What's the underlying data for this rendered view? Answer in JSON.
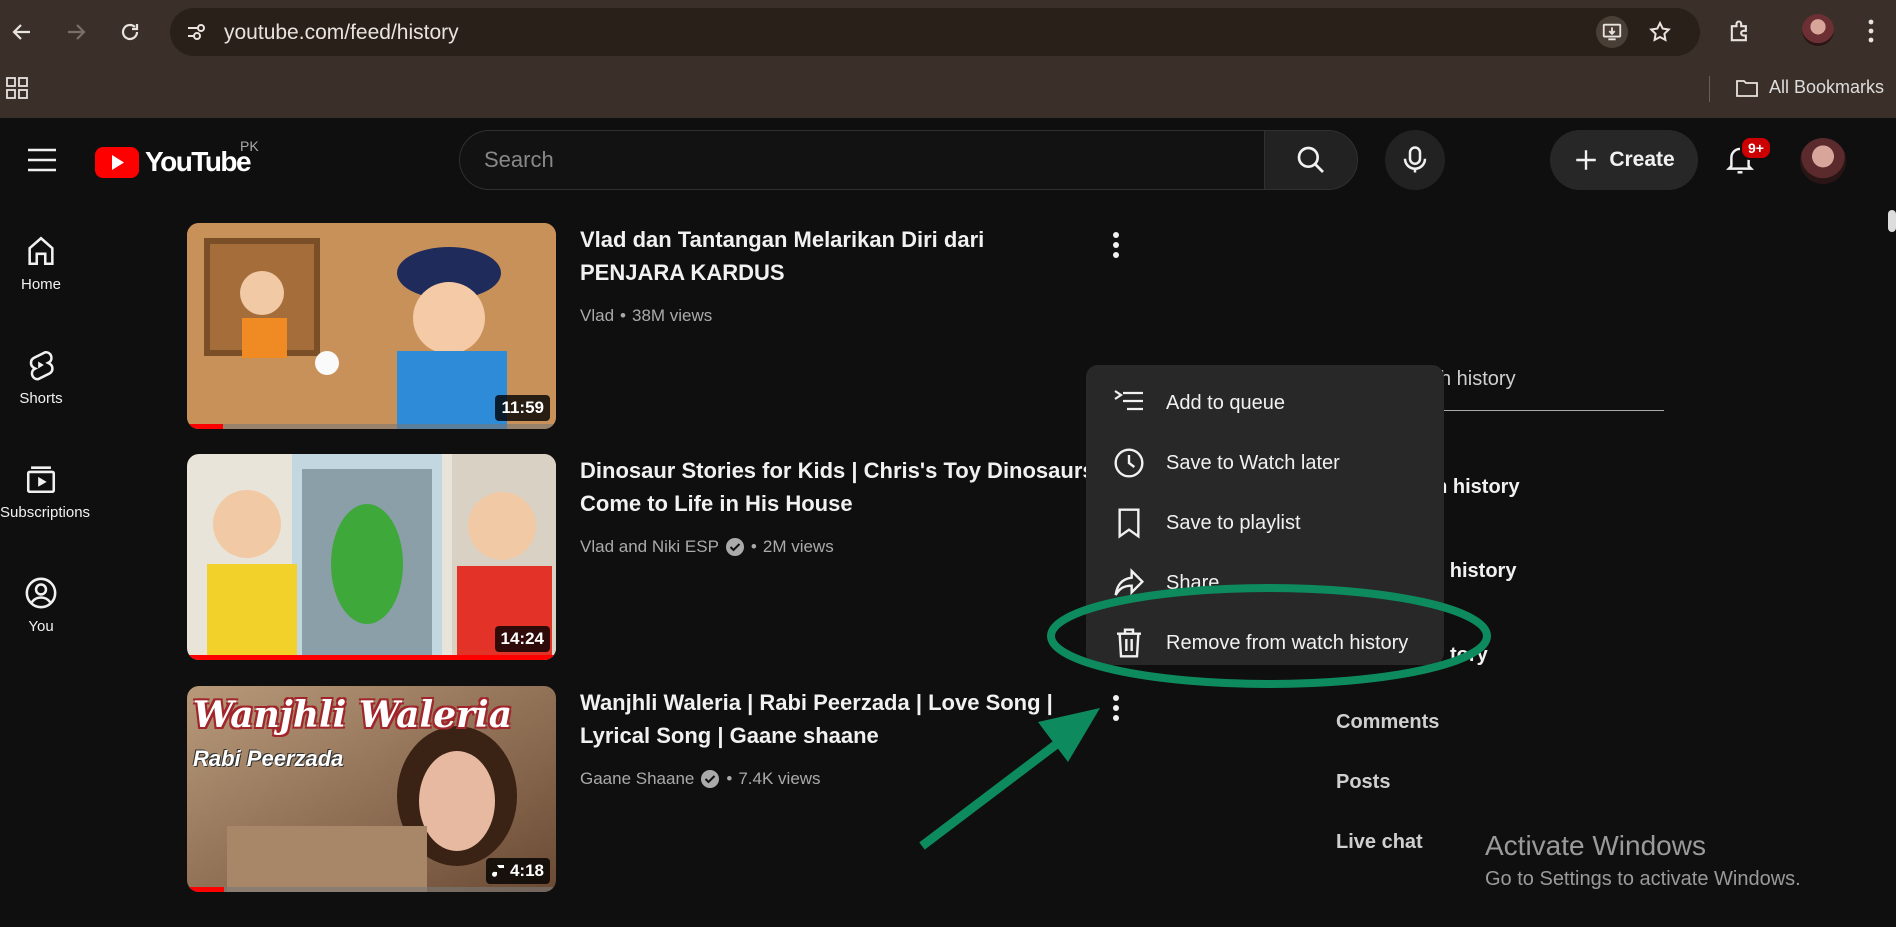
{
  "browser": {
    "url": "youtube.com/feed/history",
    "bookmarks_label": "All Bookmarks"
  },
  "masthead": {
    "logo_text": "YouTube",
    "region": "PK",
    "search_placeholder": "Search",
    "create_label": "Create",
    "notification_count": "9+"
  },
  "sidebar": {
    "items": [
      {
        "label": "Home",
        "icon": "home-icon"
      },
      {
        "label": "Shorts",
        "icon": "shorts-icon"
      },
      {
        "label": "Subscriptions",
        "icon": "subscriptions-icon"
      },
      {
        "label": "You",
        "icon": "you-icon"
      }
    ]
  },
  "videos": [
    {
      "title_line1": "Vlad dan Tantangan Melarikan Diri dari",
      "title_line2": "PENJARA KARDUS",
      "channel": "Vlad",
      "views": "38M views",
      "duration": "11:59",
      "verified": false,
      "watched": 0.08
    },
    {
      "title_line1": "Dinosaur Stories for Kids | Chris's Toy Dinosaurs",
      "title_line2": "Come to Life in His House",
      "channel": "Vlad and Niki ESP",
      "views": "2M views",
      "duration": "14:24",
      "verified": true,
      "watched": 1.0
    },
    {
      "title_line1": "Wanjhli Waleria | Rabi Peerzada | Love Song |",
      "title_line2": "Lyrical Song | Gaane shaane",
      "channel": "Gaane Shaane",
      "views": "7.4K views",
      "duration": "4:18",
      "verified": true,
      "watched": 0.1,
      "thumb_text_1": "Wanjhli Waleria",
      "thumb_text_2": "Rabi Peerzada"
    }
  ],
  "right_panel": {
    "search_partial": "ch history",
    "item1_partial": "ch history",
    "item2_partial": "h history",
    "item3_partial": "tory",
    "comments": "Comments",
    "posts": "Posts",
    "live_chat": "Live chat"
  },
  "context_menu": {
    "items": [
      {
        "label": "Add to queue",
        "icon": "queue-icon"
      },
      {
        "label": "Save to Watch later",
        "icon": "clock-icon"
      },
      {
        "label": "Save to playlist",
        "icon": "bookmark-icon"
      },
      {
        "label": "Share",
        "icon": "share-icon"
      },
      {
        "label": "Remove from watch history",
        "icon": "trash-icon"
      }
    ]
  },
  "watermark": {
    "line1": "Activate Windows",
    "line2": "Go to Settings to activate Windows."
  },
  "colors": {
    "annotation_green": "#0e8a5f",
    "yt_red": "#ff0000"
  }
}
